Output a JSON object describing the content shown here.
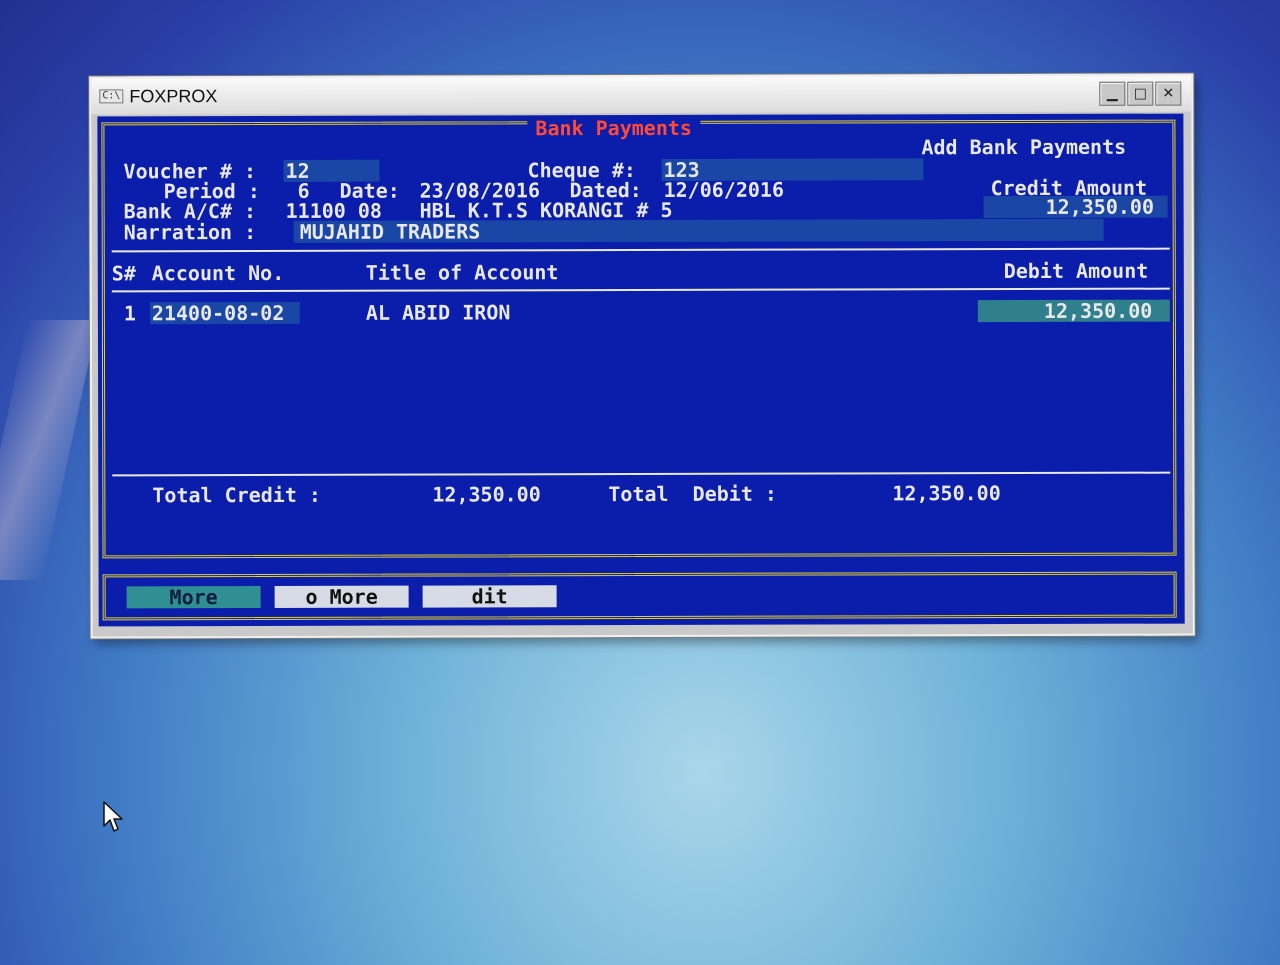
{
  "window": {
    "title": "FOXPROX",
    "icon_label": "C:\\",
    "buttons": [
      "minimize-icon",
      "maximize-icon",
      "close-icon"
    ]
  },
  "form": {
    "frame_title": "Bank Payments",
    "mode": "Add Bank Payments",
    "voucher_label": "Voucher # :",
    "voucher_value": "12",
    "cheque_label": "Cheque #:",
    "cheque_value": "123",
    "period_label": "Period :",
    "period_value": "6",
    "date_label": "Date:",
    "date_value": "23/08/2016",
    "dated_label": "Dated:",
    "dated_value": "12/06/2016",
    "credit_amount_label": "Credit Amount",
    "credit_amount_value": "12,350.00",
    "bank_label": "Bank A/C# :",
    "bank_value": "11100 08",
    "bank_name": "HBL K.T.S KORANGI # 5",
    "narration_label": "Narration :",
    "narration_value": "MUJAHID TRADERS"
  },
  "table": {
    "headers": {
      "sno": "S#",
      "account": "Account No.",
      "title": "Title of Account",
      "debit": "Debit Amount"
    },
    "rows": [
      {
        "sno": "1",
        "account": "21400-08-02",
        "title": "AL ABID IRON",
        "debit": "12,350.00"
      }
    ]
  },
  "totals": {
    "credit_label": "Total Credit :",
    "credit_value": "12,350.00",
    "debit_label": "Total  Debit :",
    "debit_value": "12,350.00"
  },
  "buttons": {
    "more": "More",
    "no_more": "o More",
    "edit": "dit"
  },
  "colors": {
    "console_bg": "#0a1dab",
    "frame": "#e7d22a",
    "title_red": "#ff4a3a",
    "field_teal": "#2f7f8c"
  }
}
